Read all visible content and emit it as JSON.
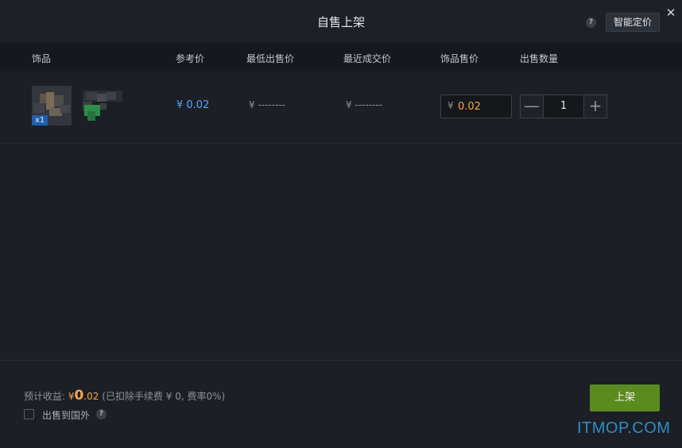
{
  "dialog": {
    "title": "自售上架",
    "help_icon": "?",
    "smart_pricing_label": "智能定价",
    "close_icon": "✕"
  },
  "table": {
    "columns": [
      "饰品",
      "参考价",
      "最低出售价",
      "最近成交价",
      "饰品售价",
      "出售数量"
    ],
    "row": {
      "item_qty": "x1",
      "ref_price": "¥ 0.02",
      "lowest_price": "¥ --------",
      "recent_price": "¥ --------",
      "price_currency": "¥",
      "price_value": "0.02",
      "quantity": "1",
      "minus": "—",
      "plus": "+"
    }
  },
  "footer": {
    "estimate_label": "预计收益:",
    "estimate_currency": "¥",
    "estimate_int": "0",
    "estimate_dec": ".02",
    "estimate_note": "(已扣除手续费 ¥ 0, 费率0%)",
    "sell_abroad_label": "出售到国外",
    "sell_abroad_checked": false,
    "help_icon": "?",
    "list_button": "上架"
  },
  "watermark": "ITMOP.COM",
  "colors": {
    "accent_blue": "#55a7ff",
    "price_orange": "#f5a74a",
    "button_green": "#5b8a1e",
    "background": "#1c1f25"
  }
}
